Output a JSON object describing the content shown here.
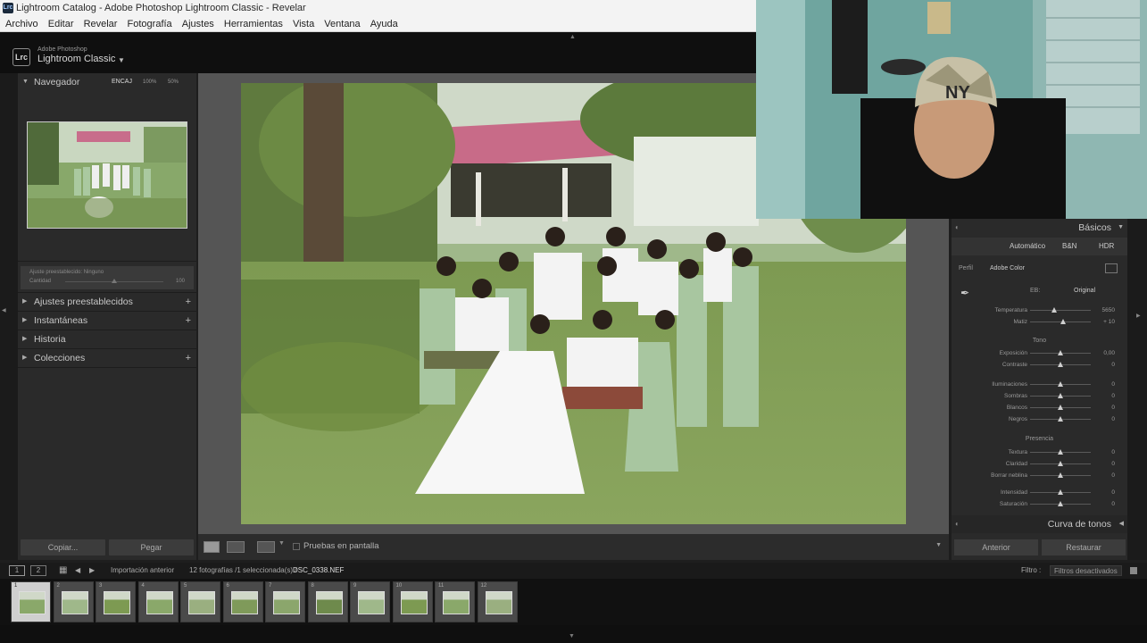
{
  "window": {
    "title": "Lightroom Catalog - Adobe Photoshop Lightroom Classic - Revelar",
    "app_badge": "Lrc"
  },
  "menu": [
    "Archivo",
    "Editar",
    "Revelar",
    "Fotografía",
    "Ajustes",
    "Herramientas",
    "Vista",
    "Ventana",
    "Ayuda"
  ],
  "identity": {
    "small": "Adobe Photoshop",
    "big": "Lightroom Classic",
    "badge": "Lrc"
  },
  "left_panel": {
    "navigator": {
      "title": "Navegador",
      "zoom_options": [
        "ENCAJ",
        "100%",
        "50%"
      ]
    },
    "preset_amount": {
      "label": "Ajuste preestablecido: Ninguno",
      "slider_label": "Cantidad",
      "slider_value": "100"
    },
    "sections": [
      {
        "label": "Ajustes preestablecidos",
        "plus": "+"
      },
      {
        "label": "Instantáneas",
        "plus": "+"
      },
      {
        "label": "Historia",
        "plus": ""
      },
      {
        "label": "Colecciones",
        "plus": "+"
      }
    ],
    "copy_label": "Copiar...",
    "paste_label": "Pegar"
  },
  "toolbar": {
    "soft_proof_label": "Pruebas en pantalla"
  },
  "right_panel": {
    "basics_title": "Básicos",
    "modes": [
      "Automático",
      "B&N",
      "HDR"
    ],
    "profile_label": "Perfil",
    "profile_value": "Adobe Color",
    "wb_label": "EB:",
    "wb_value": "Original",
    "sliders_wb": [
      {
        "label": "Temperatura",
        "value": "5650",
        "pos": 0.39
      },
      {
        "label": "Matiz",
        "value": "+ 10",
        "pos": 0.54
      }
    ],
    "tone_label": "Tono",
    "sliders_tone": [
      {
        "label": "Exposición",
        "value": "0,00",
        "pos": 0.5
      },
      {
        "label": "Contraste",
        "value": "0",
        "pos": 0.5
      },
      {
        "label": "Iluminaciones",
        "value": "0",
        "pos": 0.5
      },
      {
        "label": "Sombras",
        "value": "0",
        "pos": 0.5
      },
      {
        "label": "Blancos",
        "value": "0",
        "pos": 0.5
      },
      {
        "label": "Negros",
        "value": "0",
        "pos": 0.5
      }
    ],
    "presence_label": "Presencia",
    "sliders_presence": [
      {
        "label": "Textura",
        "value": "0",
        "pos": 0.5
      },
      {
        "label": "Claridad",
        "value": "0",
        "pos": 0.5
      },
      {
        "label": "Borrar neblina",
        "value": "0",
        "pos": 0.5
      },
      {
        "label": "Intensidad",
        "value": "0",
        "pos": 0.5
      },
      {
        "label": "Saturación",
        "value": "0",
        "pos": 0.5
      }
    ],
    "tone_curve_title": "Curva de tonos",
    "previous_label": "Anterior",
    "reset_label": "Restaurar"
  },
  "filmstrip_bar": {
    "page1": "1",
    "page2": "2",
    "source": "Importación anterior",
    "count": "12 fotografías /1 seleccionada(s) /",
    "filename": "DSC_0338.NEF",
    "filter_label": "Filtro :",
    "filter_value": "Filtros desactivados"
  },
  "filmstrip": {
    "thumbnails": [
      "1",
      "2",
      "3",
      "4",
      "5",
      "6",
      "7",
      "8",
      "9",
      "10",
      "11",
      "12"
    ],
    "selected_index": 0
  }
}
